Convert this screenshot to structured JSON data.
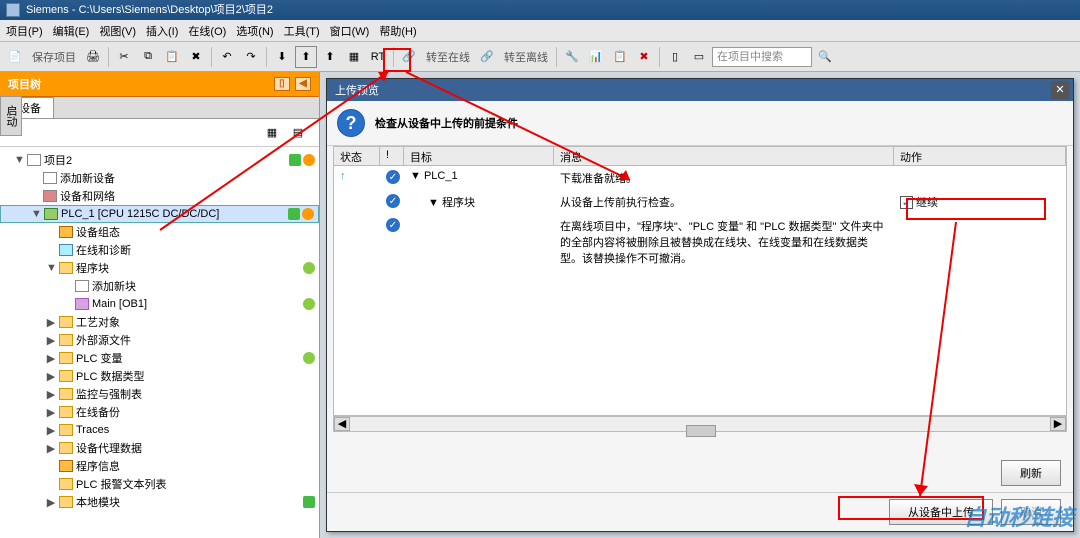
{
  "title": "Siemens  -  C:\\Users\\Siemens\\Desktop\\项目2\\项目2",
  "menu": [
    "项目(P)",
    "编辑(E)",
    "视图(V)",
    "插入(I)",
    "在线(O)",
    "选项(N)",
    "工具(T)",
    "窗口(W)",
    "帮助(H)"
  ],
  "toolbar": {
    "save": "保存项目",
    "go_online": "转至在线",
    "go_offline": "转至离线",
    "search_placeholder": "在项目中搜索"
  },
  "sidebar": {
    "title": "项目树",
    "tab": "设备",
    "vtab": "启动"
  },
  "tree": [
    {
      "ind": 0,
      "tog": "▼",
      "ico": "proj",
      "label": "项目2",
      "st": [
        "g",
        "o"
      ]
    },
    {
      "ind": 1,
      "tog": "",
      "ico": "add",
      "label": "添加新设备"
    },
    {
      "ind": 1,
      "tog": "",
      "ico": "net",
      "label": "设备和网络"
    },
    {
      "ind": 1,
      "tog": "▼",
      "ico": "plc",
      "label": "PLC_1 [CPU 1215C DC/DC/DC]",
      "sel": true,
      "st": [
        "g",
        "o"
      ]
    },
    {
      "ind": 2,
      "tog": "",
      "ico": "dev",
      "label": "设备组态"
    },
    {
      "ind": 2,
      "tog": "",
      "ico": "diag",
      "label": "在线和诊断"
    },
    {
      "ind": 2,
      "tog": "▼",
      "ico": "fold",
      "label": "程序块",
      "st": [
        "go"
      ]
    },
    {
      "ind": 3,
      "tog": "",
      "ico": "add",
      "label": "添加新块"
    },
    {
      "ind": 3,
      "tog": "",
      "ico": "blk",
      "label": "Main [OB1]",
      "st": [
        "go"
      ]
    },
    {
      "ind": 2,
      "tog": "▶",
      "ico": "fold",
      "label": "工艺对象"
    },
    {
      "ind": 2,
      "tog": "▶",
      "ico": "fold",
      "label": "外部源文件"
    },
    {
      "ind": 2,
      "tog": "▶",
      "ico": "fold",
      "label": "PLC 变量",
      "st": [
        "go"
      ]
    },
    {
      "ind": 2,
      "tog": "▶",
      "ico": "fold",
      "label": "PLC 数据类型"
    },
    {
      "ind": 2,
      "tog": "▶",
      "ico": "fold",
      "label": "监控与强制表"
    },
    {
      "ind": 2,
      "tog": "▶",
      "ico": "fold",
      "label": "在线备份"
    },
    {
      "ind": 2,
      "tog": "▶",
      "ico": "fold",
      "label": "Traces"
    },
    {
      "ind": 2,
      "tog": "▶",
      "ico": "fold",
      "label": "设备代理数据"
    },
    {
      "ind": 2,
      "tog": "",
      "ico": "dev",
      "label": "程序信息"
    },
    {
      "ind": 2,
      "tog": "",
      "ico": "fold",
      "label": "PLC 报警文本列表"
    },
    {
      "ind": 2,
      "tog": "▶",
      "ico": "fold",
      "label": "本地模块",
      "st": [
        "g"
      ]
    }
  ],
  "dialog": {
    "title": "上传预览",
    "heading": "检查从设备中上传的前提条件",
    "cols": {
      "status": "状态",
      "ex": "!",
      "target": "目标",
      "msg": "消息",
      "action": "动作"
    },
    "rows": [
      {
        "status": "↑",
        "chk": true,
        "tog": "▼",
        "target": "PLC_1",
        "msg": "下载准备就绪。",
        "action": ""
      },
      {
        "status": "",
        "chk": true,
        "tog": "▼",
        "target": "程序块",
        "msg": "从设备上传前执行检查。",
        "action": "继续",
        "actionChk": true
      },
      {
        "status": "",
        "chk": true,
        "tog": "",
        "target": "",
        "msg": "在离线项目中，\"程序块\"、\"PLC 变量\" 和 \"PLC 数据类型\" 文件夹中的全部内容将被删除且被替换成在线块、在线变量和在线数据类型。该替换操作不可撤消。",
        "action": ""
      }
    ],
    "buttons": {
      "refresh": "刷新",
      "upload": "从设备中上传",
      "cancel": "取消"
    }
  },
  "watermark": "自动秒链接"
}
